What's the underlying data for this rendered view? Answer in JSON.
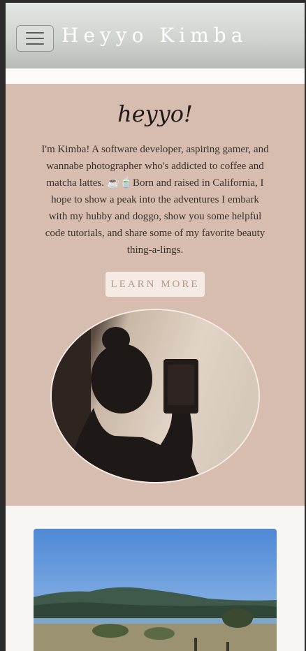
{
  "header": {
    "site_title": "Heyyo Kimba",
    "menu_icon": "hamburger-menu-icon"
  },
  "hero": {
    "heading": "heyyo!",
    "intro_text": "I'm Kimba! A software developer, aspiring gamer, and wannabe photographer who's addicted to coffee and matcha lattes. ☕🍵Born and raised in California, I hope to show a peak into the adventures I embark with my hubby and doggo, show you some helpful code tutorials, and share some of my favorite beauty thing-a-lings.",
    "cta_label": "LEARN MORE"
  },
  "colors": {
    "hero_background": "#d7bdaf",
    "button_background": "#f5ebe4",
    "button_text": "#b59a8c",
    "page_background": "#f8f6f4"
  }
}
